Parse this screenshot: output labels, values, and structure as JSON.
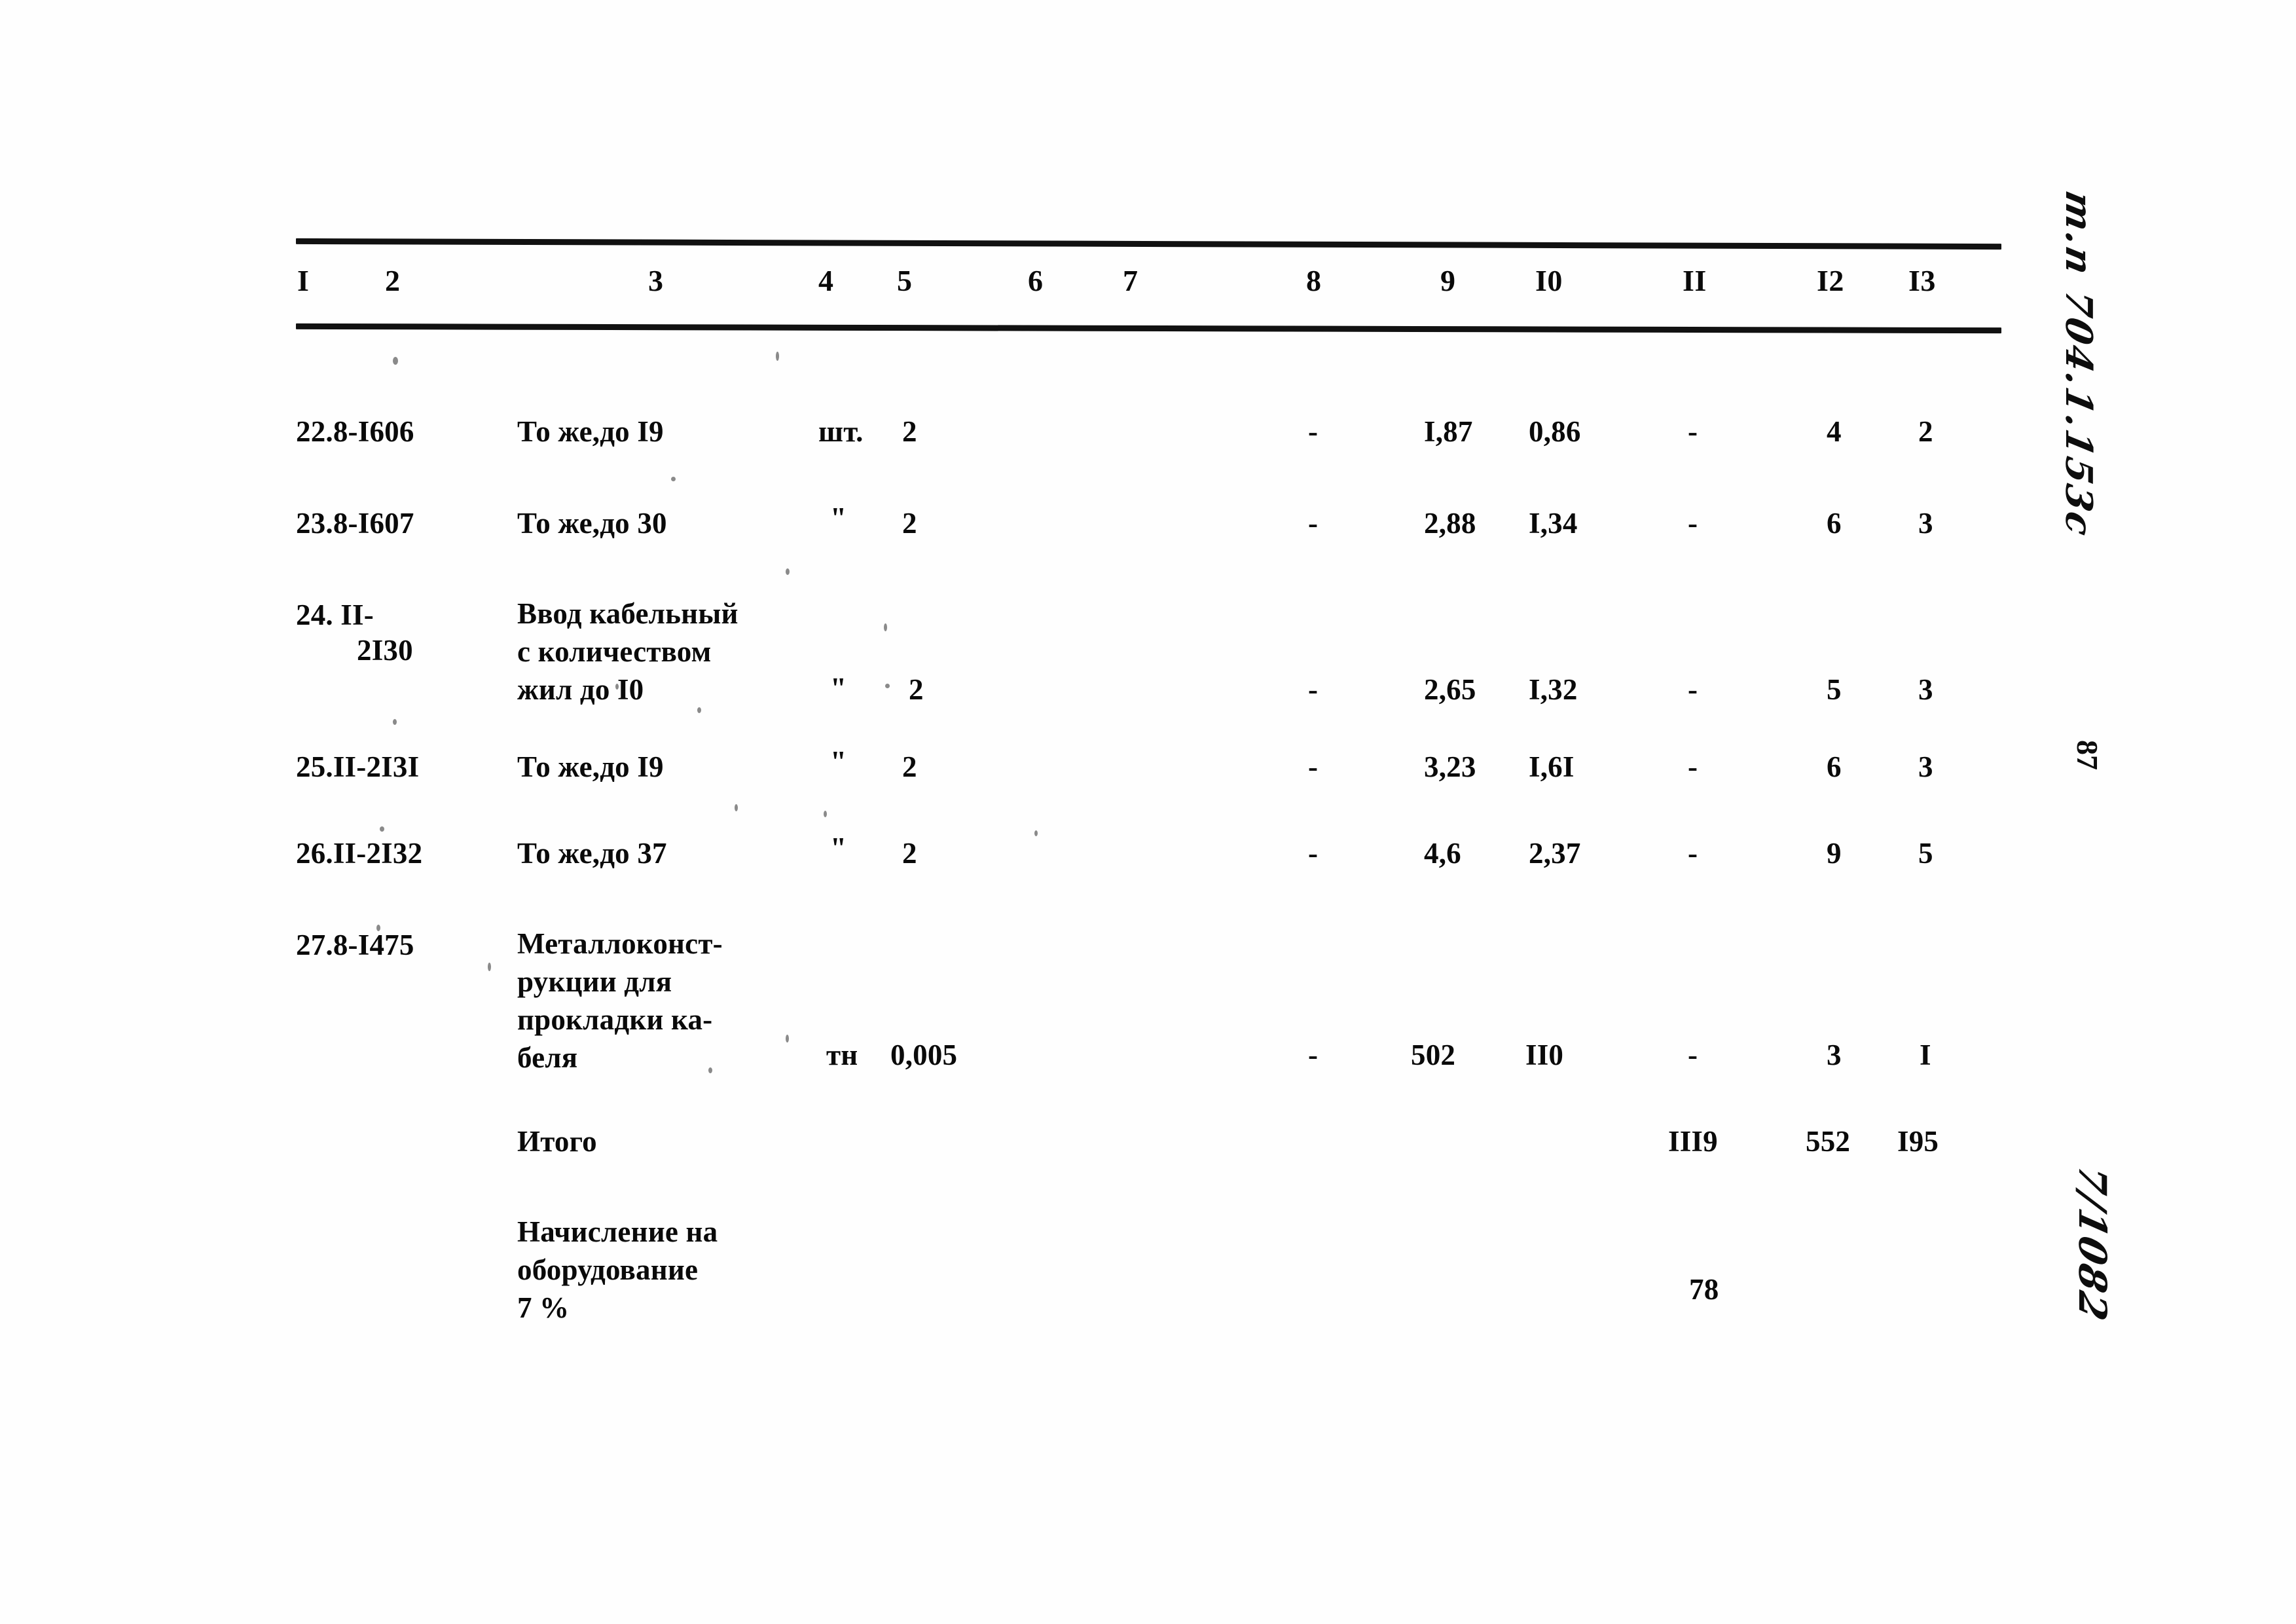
{
  "document": {
    "type": "scanned-estimate-table",
    "page_number": "87",
    "margin_code": "т.п 704.1.153с",
    "margin_number": "7/1082"
  },
  "table": {
    "headers": [
      "I",
      "2",
      "3",
      "4",
      "5",
      "6",
      "7",
      "8",
      "9",
      "I0",
      "II",
      "I2",
      "I3"
    ],
    "rows": [
      {
        "num_code": "22.8-I606",
        "name": "То же,до I9",
        "unit": "шт.",
        "qty": "2",
        "c6": "",
        "c7": "",
        "c8": "-",
        "c9": "I,87",
        "c10": "0,86",
        "c11": "-",
        "c12": "4",
        "c13": "2"
      },
      {
        "num_code": "23.8-I607",
        "name": "То же,до 30",
        "unit": "\"",
        "qty": "2",
        "c6": "",
        "c7": "",
        "c8": "-",
        "c9": "2,88",
        "c10": "I,34",
        "c11": "-",
        "c12": "6",
        "c13": "3"
      },
      {
        "num_code": "24. II-",
        "num_code2": "2I30",
        "name": "Ввод кабельный\nс количеством\nжил до I0",
        "unit": "\"",
        "qty": "2",
        "c6": "",
        "c7": "",
        "c8": "-",
        "c9": "2,65",
        "c10": "I,32",
        "c11": "-",
        "c12": "5",
        "c13": "3"
      },
      {
        "num_code": "25.II-2I3I",
        "name": "То же,до I9",
        "unit": "\"",
        "qty": "2",
        "c6": "",
        "c7": "",
        "c8": "-",
        "c9": "3,23",
        "c10": "I,6I",
        "c11": "-",
        "c12": "6",
        "c13": "3"
      },
      {
        "num_code": "26.II-2I32",
        "name": "То же,до 37",
        "unit": "\"",
        "qty": "2",
        "c6": "",
        "c7": "",
        "c8": "-",
        "c9": "4,6",
        "c10": "2,37",
        "c11": "-",
        "c12": "9",
        "c13": "5"
      },
      {
        "num_code": "27.8-I475",
        "name": "Металлоконст-\nрукции для\nпрокладки ка-\nбеля",
        "unit": "тн",
        "qty": "0,005",
        "c6": "",
        "c7": "",
        "c8": "-",
        "c9": "502",
        "c10": "II0",
        "c11": "-",
        "c12": "3",
        "c13": "I"
      }
    ],
    "total_row": {
      "label": "Итого",
      "c11": "III9",
      "c12": "552",
      "c13": "I95"
    },
    "surcharge_row": {
      "label": "Начисление на\nоборудование\n7 %",
      "value": "78"
    }
  }
}
